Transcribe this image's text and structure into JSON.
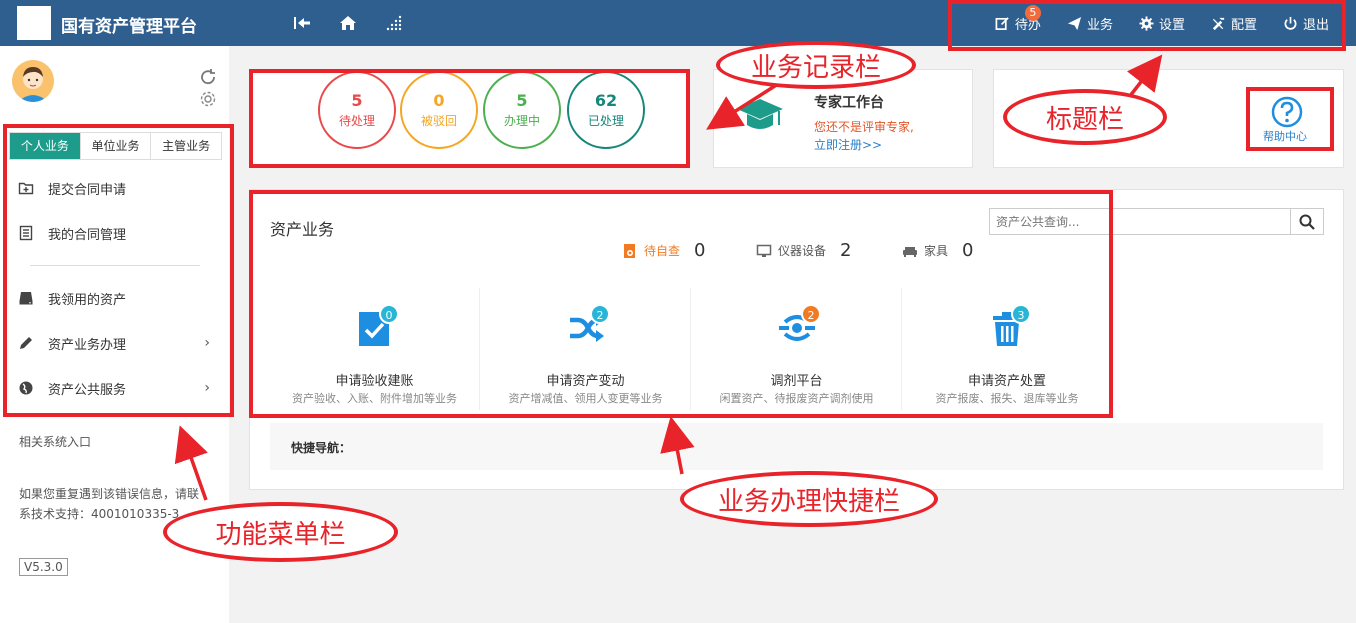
{
  "header": {
    "title": "国有资产管理平台",
    "actions": [
      {
        "label": "待办",
        "badge": "5",
        "icon": "edit-icon"
      },
      {
        "label": "业务",
        "icon": "send-icon"
      },
      {
        "label": "设置",
        "icon": "gear-icon"
      },
      {
        "label": "配置",
        "icon": "tools-icon"
      },
      {
        "label": "退出",
        "icon": "power-icon"
      }
    ]
  },
  "sidebar": {
    "tabs": [
      "个人业务",
      "单位业务",
      "主管业务"
    ],
    "active_tab": "个人业务",
    "items": [
      {
        "label": "提交合同申请",
        "icon": "add-folder-icon"
      },
      {
        "label": "我的合同管理",
        "icon": "document-list-icon"
      },
      {
        "label": "我领用的资产",
        "icon": "hard-drive-icon"
      },
      {
        "label": "资产业务办理",
        "icon": "pencil-icon",
        "arrow": "›"
      },
      {
        "label": "资产公共服务",
        "icon": "globe-icon",
        "arrow": "›"
      }
    ],
    "related_label": "相关系统入口",
    "support_line1": "如果您重复遇到该错误信息，请联",
    "support_line2": "系技术支持：4001010335-3",
    "version": "V5.3.0"
  },
  "records": [
    {
      "value": "5",
      "label": "待处理",
      "color": "#e84a4a"
    },
    {
      "value": "0",
      "label": "被驳回",
      "color": "#f5a623"
    },
    {
      "value": "5",
      "label": "办理中",
      "color": "#4caf50"
    },
    {
      "value": "62",
      "label": "已处理",
      "color": "#17877a"
    }
  ],
  "expert": {
    "title": "专家工作台",
    "note": "您还不是评审专家,",
    "link": "立即注册>>"
  },
  "help": {
    "label": "帮助中心"
  },
  "asset_section": {
    "title": "资产业务",
    "search_placeholder": "资产公共查询...",
    "stats": [
      {
        "label": "待自查",
        "value": "0",
        "color": "#f07b22",
        "icon": "eye-icon"
      },
      {
        "label": "仪器设备",
        "value": "2",
        "color": "#666666",
        "icon": "monitor-icon"
      },
      {
        "label": "家具",
        "value": "0",
        "color": "#666666",
        "icon": "sofa-icon"
      }
    ],
    "tiles": [
      {
        "name": "申请验收建账",
        "desc": "资产验收、入账、附件增加等业务",
        "badge": "0",
        "badge_color": "#29b6d6",
        "icon": "check-document-icon"
      },
      {
        "name": "申请资产变动",
        "desc": "资产增减值、领用人变更等业务",
        "badge": "2",
        "badge_color": "#29b6d6",
        "icon": "shuffle-icon"
      },
      {
        "name": "调剂平台",
        "desc": "闲置资产、待报废资产调剂使用",
        "badge": "2",
        "badge_color": "#f07b22",
        "icon": "link-eye-icon"
      },
      {
        "name": "申请资产处置",
        "desc": "资产报废、报失、退库等业务",
        "badge": "3",
        "badge_color": "#29b6d6",
        "icon": "trash-icon"
      }
    ],
    "quick_nav_label": "快捷导航："
  },
  "annotations": {
    "records": "业务记录栏",
    "title_bar": "标题栏",
    "menu": "功能菜单栏",
    "shortcuts": "业务办理快捷栏"
  },
  "colors": {
    "header_bg": "#2f5f8f",
    "accent": "#1e9c8b",
    "annotation_red": "#e8232a",
    "icon_blue": "#1e8fe0"
  }
}
